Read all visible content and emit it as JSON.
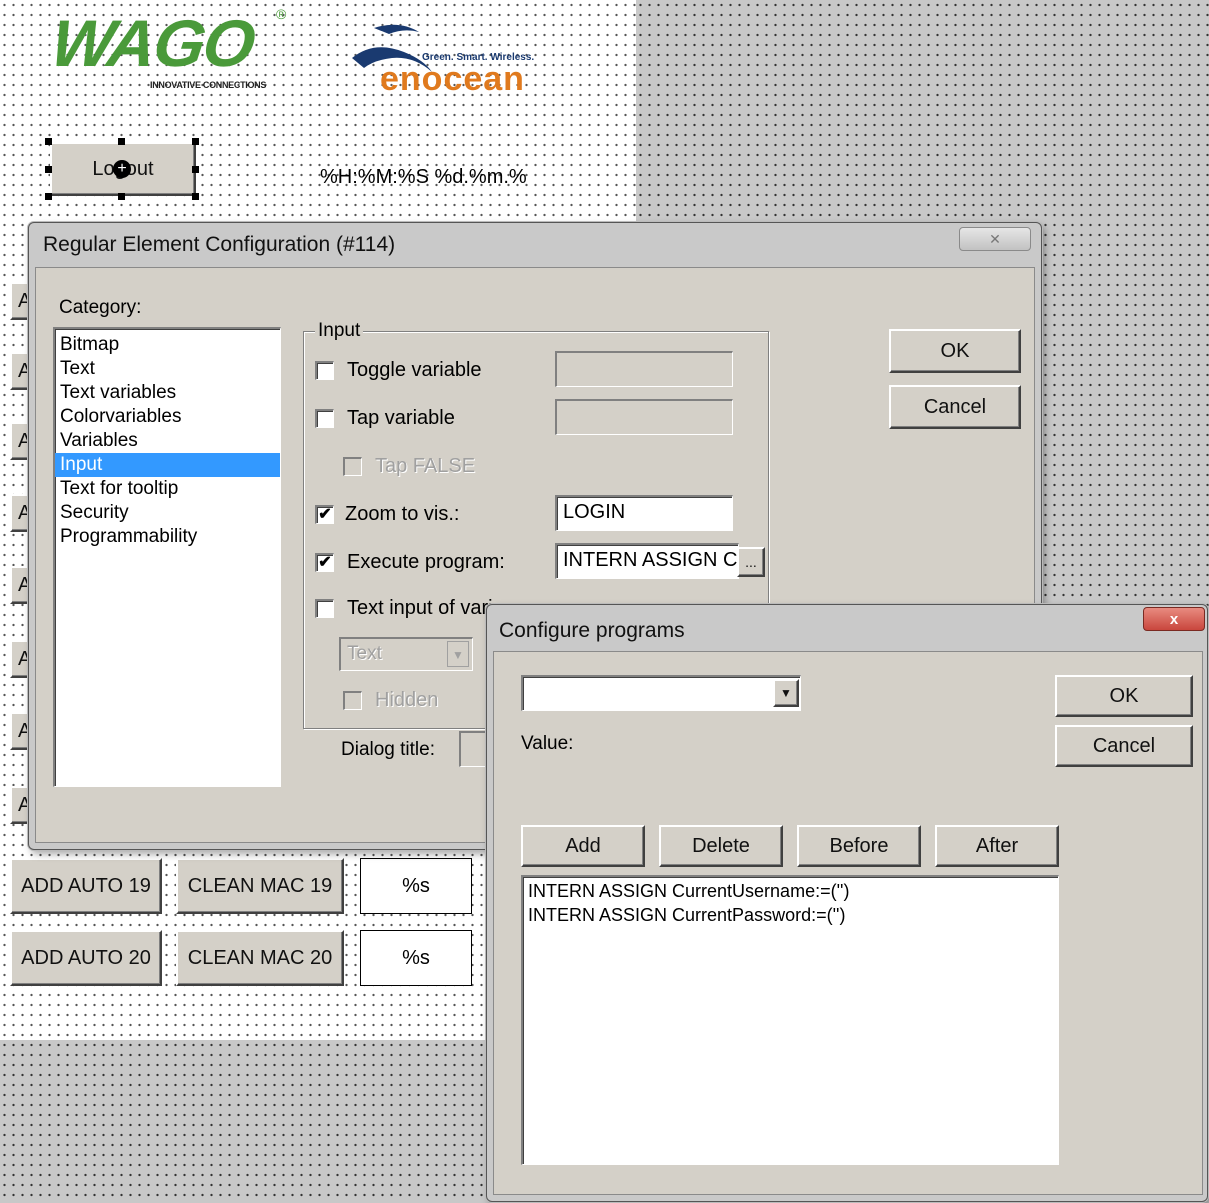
{
  "header": {
    "wago_logo_text": "WAGO",
    "wago_tagline": "INNOVATIVE CONNECTIONS",
    "enocean_logo_text": "enocean",
    "enocean_tagline": "Green. Smart. Wireless."
  },
  "canvas": {
    "logout_button_label": "Logout",
    "datetime_format": "%H:%M:%S  %d.%m.%",
    "rows": [
      {
        "add_label": "ADD AUTO 19",
        "clean_label": "CLEAN MAC 19",
        "value": "%s"
      },
      {
        "add_label": "ADD AUTO 20",
        "clean_label": "CLEAN MAC 20",
        "value": "%s"
      }
    ],
    "left_stub_letter": "A"
  },
  "element_config_dialog": {
    "title": "Regular Element Configuration (#114)",
    "close_glyph": "✕",
    "category_label": "Category:",
    "categories": [
      "Bitmap",
      "Text",
      "Text variables",
      "Colorvariables",
      "Variables",
      "Input",
      "Text for tooltip",
      "Security",
      "Programmability"
    ],
    "selected_category": "Input",
    "group_label": "Input",
    "toggle_variable": {
      "label": "Toggle variable",
      "checked": false,
      "value": ""
    },
    "tap_variable": {
      "label": "Tap variable",
      "checked": false,
      "value": ""
    },
    "tap_false": {
      "label": "Tap FALSE",
      "checked": false
    },
    "zoom_to_vis": {
      "label": "Zoom to vis.:",
      "checked": true,
      "value": "LOGIN"
    },
    "execute_program": {
      "label": "Execute program:",
      "checked": true,
      "value": "INTERN ASSIGN C",
      "browse_label": "..."
    },
    "text_input": {
      "label": "Text input of vari",
      "checked": false
    },
    "text_dropdown_value": "Text",
    "hidden": {
      "label": "Hidden",
      "checked": false
    },
    "dialog_title_label": "Dialog title:",
    "ok_label": "OK",
    "cancel_label": "Cancel"
  },
  "configure_programs_dialog": {
    "title": "Configure programs",
    "close_glyph": "x",
    "dropdown_value": "",
    "value_label": "Value:",
    "ok_label": "OK",
    "cancel_label": "Cancel",
    "add_label": "Add",
    "delete_label": "Delete",
    "before_label": "Before",
    "after_label": "After",
    "programs": [
      "INTERN ASSIGN CurrentUsername:=('')",
      "INTERN ASSIGN CurrentPassword:=('')"
    ]
  },
  "colors": {
    "selection": "#3399ff",
    "wago_green": "#4a9a3a",
    "close_red": "#c9463d"
  }
}
